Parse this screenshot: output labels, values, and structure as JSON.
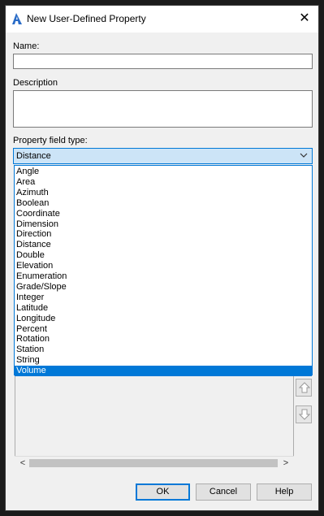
{
  "window": {
    "title": "New User-Defined Property",
    "close_symbol": "✕"
  },
  "form": {
    "name_label": "Name:",
    "name_value": "",
    "description_label": "Description",
    "description_value": "",
    "type_label": "Property field type:",
    "type_value": "Distance"
  },
  "dropdown": {
    "options": [
      "Angle",
      "Area",
      "Azimuth",
      "Boolean",
      "Coordinate",
      "Dimension",
      "Direction",
      "Distance",
      "Double",
      "Elevation",
      "Enumeration",
      "Grade/Slope",
      "Integer",
      "Latitude",
      "Longitude",
      "Percent",
      "Rotation",
      "Station",
      "String",
      "Volume"
    ],
    "highlighted": "Volume"
  },
  "scroll": {
    "left_arrow": "<",
    "right_arrow": ">"
  },
  "buttons": {
    "ok": "OK",
    "cancel": "Cancel",
    "help": "Help"
  },
  "colors": {
    "accent": "#0078d7",
    "select_bg": "#cce4f7",
    "dialog_bg": "#f0f0f0",
    "app_icon": "#2a6cc7"
  }
}
